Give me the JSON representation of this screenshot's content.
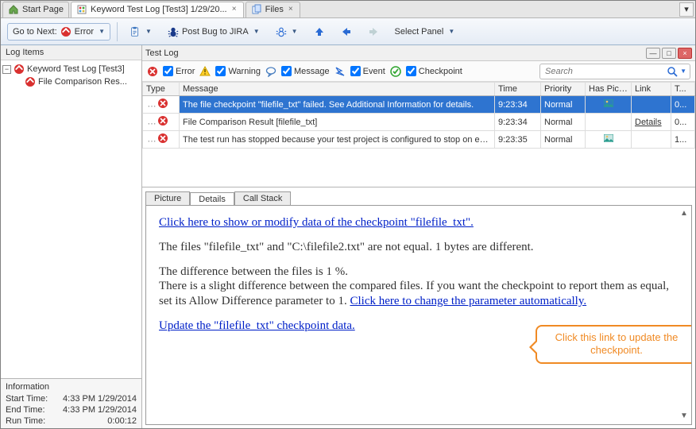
{
  "tabs": [
    {
      "label": "Start Page",
      "icon": "home"
    },
    {
      "label": "Keyword Test Log [Test3] 1/29/20...",
      "icon": "log",
      "active": true
    },
    {
      "label": "Files",
      "icon": "files"
    }
  ],
  "toolbar": {
    "go_label": "Go to Next:",
    "error_label": "Error",
    "post_bug_label": "Post Bug to JIRA",
    "select_panel_label": "Select Panel"
  },
  "left_panel": {
    "title": "Log Items",
    "root": "Keyword Test Log [Test3]",
    "child": "File Comparison Res..."
  },
  "info": {
    "title": "Information",
    "rows": [
      {
        "label": "Start Time:",
        "value": "4:33 PM 1/29/2014"
      },
      {
        "label": "End Time:",
        "value": "4:33 PM 1/29/2014"
      },
      {
        "label": "Run Time:",
        "value": "0:00:12"
      }
    ]
  },
  "test_log": {
    "title": "Test Log",
    "filters": {
      "error": "Error",
      "warning": "Warning",
      "message": "Message",
      "event": "Event",
      "checkpoint": "Checkpoint"
    },
    "search_placeholder": "Search",
    "columns": [
      "Type",
      "Message",
      "Time",
      "Priority",
      "Has Pict...",
      "Link",
      "T..."
    ],
    "rows": [
      {
        "icon": "error",
        "message": "The file checkpoint \"filefile_txt\" failed. See Additional Information for details.",
        "time": "9:23:34",
        "priority": "Normal",
        "pic": true,
        "link": "",
        "t": "0...",
        "selected": true
      },
      {
        "icon": "error",
        "message": "File Comparison Result [filefile_txt]",
        "time": "9:23:34",
        "priority": "Normal",
        "pic": false,
        "link": "Details",
        "t": "0..."
      },
      {
        "icon": "error",
        "message": "The test run has stopped because your test project is configured to stop on errors.",
        "time": "9:23:35",
        "priority": "Normal",
        "pic": true,
        "link": "",
        "t": "1..."
      }
    ]
  },
  "detail_tabs": [
    "Picture",
    "Details",
    "Call Stack"
  ],
  "detail_active": 1,
  "details": {
    "link_show": "Click here to show or modify data of the checkpoint \"filefile_txt\".",
    "p_files": "The files \"filefile_txt\" and \"C:\\filefile2.txt\" are not equal. 1 bytes are different.",
    "p_diff1": "The difference between the files is 1 %.",
    "p_diff2a": "There is a slight difference between the compared files. If you want the checkpoint to report them as equal, set its Allow Difference parameter to 1. ",
    "link_auto": "Click here to change the parameter automatically.",
    "link_update": "Update the \"filefile_txt\" checkpoint data."
  },
  "callout": "Click this link to update the checkpoint."
}
